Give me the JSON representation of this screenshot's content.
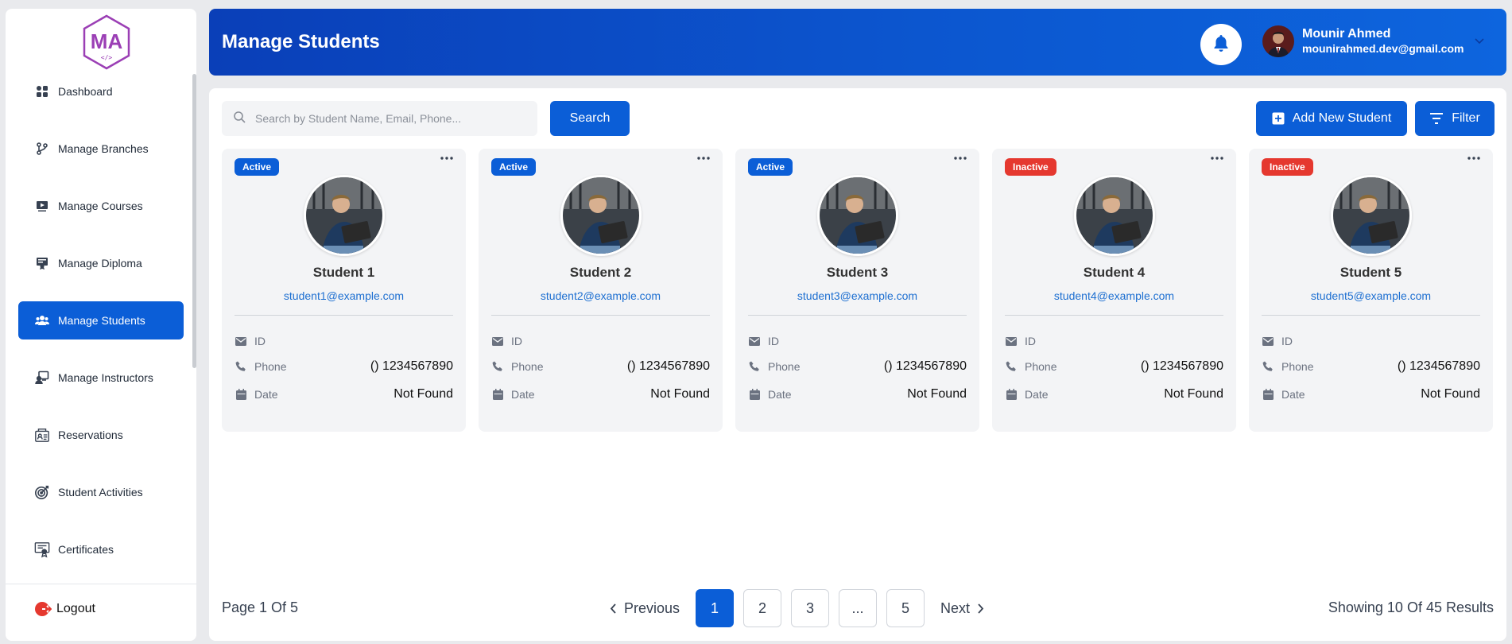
{
  "sidebar": {
    "logo_text": "MA",
    "items": [
      {
        "label": "Dashboard",
        "icon": "dashboard-icon",
        "active": false
      },
      {
        "label": "Manage Branches",
        "icon": "branch-icon",
        "active": false
      },
      {
        "label": "Manage Courses",
        "icon": "video-icon",
        "active": false
      },
      {
        "label": "Manage Diploma",
        "icon": "diploma-icon",
        "active": false
      },
      {
        "label": "Manage Students",
        "icon": "students-icon",
        "active": true
      },
      {
        "label": "Manage Instructors",
        "icon": "instructor-icon",
        "active": false
      },
      {
        "label": "Reservations",
        "icon": "reservation-icon",
        "active": false
      },
      {
        "label": "Student Activities",
        "icon": "target-icon",
        "active": false
      },
      {
        "label": "Certificates",
        "icon": "certificate-icon",
        "active": false
      }
    ],
    "logout_label": "Logout"
  },
  "header": {
    "title": "Manage Students",
    "user_name": "Mounir Ahmed",
    "user_email": "mounirahmed.dev@gmail.com"
  },
  "toolbar": {
    "search_placeholder": "Search by Student Name, Email, Phone...",
    "search_label": "Search",
    "add_label": "Add New Student",
    "filter_label": "Filter"
  },
  "labels": {
    "id": "ID",
    "phone": "Phone",
    "date": "Date"
  },
  "students": [
    {
      "status": "Active",
      "name": "Student 1",
      "email": "student1@example.com",
      "phone": "() 1234567890",
      "date": "Not Found"
    },
    {
      "status": "Active",
      "name": "Student 2",
      "email": "student2@example.com",
      "phone": "() 1234567890",
      "date": "Not Found"
    },
    {
      "status": "Active",
      "name": "Student 3",
      "email": "student3@example.com",
      "phone": "() 1234567890",
      "date": "Not Found"
    },
    {
      "status": "Inactive",
      "name": "Student 4",
      "email": "student4@example.com",
      "phone": "() 1234567890",
      "date": "Not Found"
    },
    {
      "status": "Inactive",
      "name": "Student 5",
      "email": "student5@example.com",
      "phone": "() 1234567890",
      "date": "Not Found"
    }
  ],
  "pagination": {
    "page_info": "Page 1 Of 5",
    "previous_label": "Previous",
    "next_label": "Next",
    "pages": [
      "1",
      "2",
      "3",
      "...",
      "5"
    ],
    "results": "Showing 10 Of 45 Results"
  },
  "colors": {
    "accent": "#0b5ed7",
    "inactive": "#e5382f",
    "logo": "#9b3fb5"
  }
}
